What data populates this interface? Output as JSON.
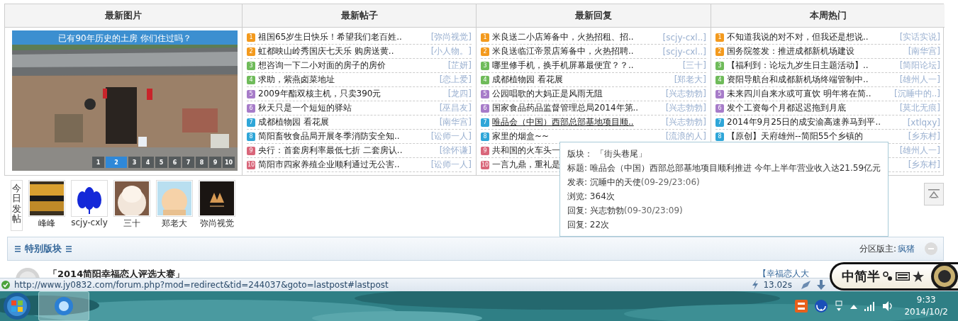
{
  "columns": [
    {
      "title": "最新图片"
    },
    {
      "title": "最新帖子"
    },
    {
      "title": "最新回复"
    },
    {
      "title": "本周热门"
    }
  ],
  "slideshow": {
    "caption": "已有90年历史的土房  你们住过吗？",
    "pages": [
      {
        "label": "1",
        "selected": false
      },
      {
        "label": "2",
        "selected": true
      },
      {
        "label": "3",
        "selected": false
      },
      {
        "label": "4",
        "selected": false
      },
      {
        "label": "5",
        "selected": false
      },
      {
        "label": "6",
        "selected": false
      },
      {
        "label": "7",
        "selected": false
      },
      {
        "label": "8",
        "selected": false
      },
      {
        "label": "9",
        "selected": false
      },
      {
        "label": "10",
        "selected": false
      }
    ]
  },
  "new_posts": [
    {
      "rank": "1",
      "color": "#f39a1e",
      "title": "祖国65岁生日快乐！希望我们老百姓..",
      "author": "[弥尚视觉]"
    },
    {
      "rank": "2",
      "color": "#f39a1e",
      "title": "虹都映山岭秀国庆七天乐 购房送黄..",
      "author": "[小人物。]"
    },
    {
      "rank": "3",
      "color": "#6fbb5a",
      "title": "想咨询一下二小对面的房子的房价",
      "author": "[芷妍]"
    },
    {
      "rank": "4",
      "color": "#6fbb5a",
      "title": "求助，紫燕卤菜地址",
      "author": "[恋上爱]"
    },
    {
      "rank": "5",
      "color": "#a77cc9",
      "title": "2009年酯双核主机，只卖390元",
      "author": "[龙四]"
    },
    {
      "rank": "6",
      "color": "#a77cc9",
      "title": "秋天只是一个短短的驿站",
      "author": "[巫昌友]"
    },
    {
      "rank": "7",
      "color": "#2fa6d8",
      "title": "成都植物园 看花展",
      "author": "[南华宫]"
    },
    {
      "rank": "8",
      "color": "#2fa6d8",
      "title": "简阳畜牧食品局开展冬季消防安全知..",
      "author": "[讼师一人]"
    },
    {
      "rank": "9",
      "color": "#d9667a",
      "title": "央行：首套房利率最低七折 二套房认..",
      "author": "[徐怀谦]"
    },
    {
      "rank": "10",
      "color": "#d9667a",
      "title": "简阳市四家养殖企业顺利通过无公害..",
      "author": "[讼师一人]"
    }
  ],
  "new_replies": [
    {
      "rank": "1",
      "color": "#f39a1e",
      "title": "米良送二小店筹备中，火热招租、招..",
      "author": "[scjy-cxl..]",
      "hovered": false
    },
    {
      "rank": "2",
      "color": "#f39a1e",
      "title": "米良送临江帝景店筹备中，火热招聘..",
      "author": "[scjy-cxl..]",
      "hovered": false
    },
    {
      "rank": "3",
      "color": "#6fbb5a",
      "title": "哪里修手机，换手机屏幕最便宜？？..",
      "author": "[三十]",
      "hovered": false
    },
    {
      "rank": "4",
      "color": "#6fbb5a",
      "title": "成都植物园 看花展",
      "author": "[郑老大]",
      "hovered": false
    },
    {
      "rank": "5",
      "color": "#a77cc9",
      "title": "公园唱歌的大妈正是风雨无阻",
      "author": "[兴志勃勃]",
      "hovered": false
    },
    {
      "rank": "6",
      "color": "#a77cc9",
      "title": "国家食品药品监督管理总局2014年第..",
      "author": "[兴志勃勃]",
      "hovered": false
    },
    {
      "rank": "7",
      "color": "#2fa6d8",
      "title": "唯品会（中国）西部总部基地项目顺..",
      "author": "[兴志勃勃]",
      "hovered": true
    },
    {
      "rank": "8",
      "color": "#2fa6d8",
      "title": "家里的烟盒~~",
      "author": "[流浪的人]",
      "hovered": false
    },
    {
      "rank": "9",
      "color": "#d9667a",
      "title": "共和国的火车头一",
      "hovered": false
    },
    {
      "rank": "10",
      "color": "#d9667a",
      "title": "一言九鼎，重礼是",
      "hovered": false
    }
  ],
  "weekly_hot": [
    {
      "rank": "1",
      "color": "#f39a1e",
      "title": "不知道我说的对不对，但我还是想说..",
      "author": "[实话实说]"
    },
    {
      "rank": "2",
      "color": "#f39a1e",
      "title": "国务院签发：推进成都新机场建设",
      "author": "[南华宫]"
    },
    {
      "rank": "3",
      "color": "#6fbb5a",
      "title": "【福利到：论坛九岁生日主题活动】..",
      "author": "[简阳论坛]"
    },
    {
      "rank": "4",
      "color": "#6fbb5a",
      "title": "资阳导航台和成都新机场终端管制中..",
      "author": "[雄州人一]"
    },
    {
      "rank": "5",
      "color": "#a77cc9",
      "title": "未来四川自来水或可直饮 明年将在简..",
      "author": "[沉睡中的..]"
    },
    {
      "rank": "6",
      "color": "#a77cc9",
      "title": "发个工资每个月都迟迟拖到月底",
      "author": "[莫北无痕]"
    },
    {
      "rank": "7",
      "color": "#2fa6d8",
      "title": "2014年9月25日的成安渝高速养马到平..",
      "author": "[xtlqxy]"
    },
    {
      "rank": "8",
      "color": "#2fa6d8",
      "title": "【原创】天府雄州--简阳55个乡镇的",
      "author": "[乡东村]"
    },
    {
      "author": "[雄州人一]"
    },
    {
      "author": "[乡东村]"
    }
  ],
  "today_posters": {
    "label": "今日发帖",
    "users": [
      {
        "name": "峰峰"
      },
      {
        "name": "scjy-cxly"
      },
      {
        "name": "三十"
      },
      {
        "name": "郑老大"
      },
      {
        "name": "弥尚视觉"
      }
    ]
  },
  "section": {
    "title": "特别版块",
    "moderator_label": "分区版主:",
    "moderator": "疯猪",
    "forums": [
      {
        "title": "「2014简阳幸福恋人评选大赛」",
        "latest": "【幸福恋人大"
      }
    ]
  },
  "tooltip": [
    {
      "label": "版块：",
      "value": "「街头巷尾」"
    },
    {
      "label": "标题:",
      "value": "唯品会（中国）西部总部基地项目顺利推进 今年上半年营业收入达21.59亿元"
    },
    {
      "label": "发表:",
      "value": "沉睡中的天使",
      "time": "(09-29/23:06)"
    },
    {
      "label": "浏览:",
      "value": "364次"
    },
    {
      "label": "回复:",
      "value": "兴志勃勃",
      "time": "(09-30/23:09)"
    },
    {
      "label": "回复:",
      "value": "22次"
    }
  ],
  "ime_bar": {
    "text": "中简半"
  },
  "status_bar": {
    "url": "http://www.jy0832.com/forum.php?mod=redirect&tid=244037&goto=lastpost#lastpost",
    "load_time": "13.02s"
  },
  "taskbar": {
    "time": "9:33",
    "date": "2014/10/2"
  }
}
